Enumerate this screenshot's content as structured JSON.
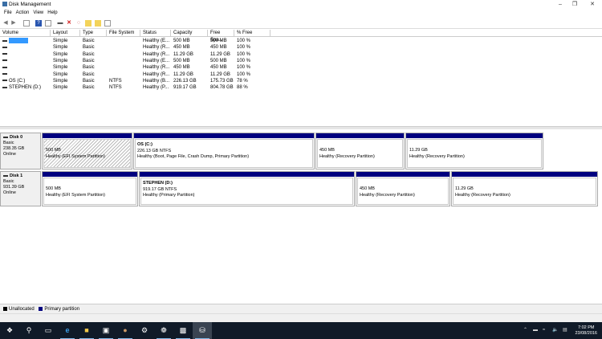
{
  "window": {
    "title": "Disk Management",
    "controls": [
      "minimize",
      "maximize",
      "close"
    ]
  },
  "menu": [
    "File",
    "Action",
    "View",
    "Help"
  ],
  "toolbar": [
    "back-icon",
    "forward-icon",
    "console-tree-icon",
    "help-icon",
    "properties-icon",
    "connect-icon",
    "delete-icon",
    "refresh-icon",
    "new-icon",
    "open-icon",
    "view-icon"
  ],
  "list": {
    "columns": [
      "Volume",
      "Layout",
      "Type",
      "File System",
      "Status",
      "Capacity",
      "Free Spa...",
      "% Free"
    ],
    "rows": [
      {
        "volume": "",
        "layout": "Simple",
        "type": "Basic",
        "fs": "",
        "status": "Healthy (E...",
        "capacity": "500 MB",
        "free": "500 MB",
        "pct": "100 %",
        "selected": true
      },
      {
        "volume": "",
        "layout": "Simple",
        "type": "Basic",
        "fs": "",
        "status": "Healthy (R...",
        "capacity": "450 MB",
        "free": "450 MB",
        "pct": "100 %"
      },
      {
        "volume": "",
        "layout": "Simple",
        "type": "Basic",
        "fs": "",
        "status": "Healthy (R...",
        "capacity": "11.29 GB",
        "free": "11.29 GB",
        "pct": "100 %"
      },
      {
        "volume": "",
        "layout": "Simple",
        "type": "Basic",
        "fs": "",
        "status": "Healthy (E...",
        "capacity": "500 MB",
        "free": "500 MB",
        "pct": "100 %"
      },
      {
        "volume": "",
        "layout": "Simple",
        "type": "Basic",
        "fs": "",
        "status": "Healthy (R...",
        "capacity": "450 MB",
        "free": "450 MB",
        "pct": "100 %"
      },
      {
        "volume": "",
        "layout": "Simple",
        "type": "Basic",
        "fs": "",
        "status": "Healthy (R...",
        "capacity": "11.29 GB",
        "free": "11.29 GB",
        "pct": "100 %"
      },
      {
        "volume": "OS (C:)",
        "layout": "Simple",
        "type": "Basic",
        "fs": "NTFS",
        "status": "Healthy (B...",
        "capacity": "226.13 GB",
        "free": "175.73 GB",
        "pct": "78 %"
      },
      {
        "volume": "STEPHEN (D:)",
        "layout": "Simple",
        "type": "Basic",
        "fs": "NTFS",
        "status": "Healthy (P...",
        "capacity": "919.17 GB",
        "free": "804.78 GB",
        "pct": "88 %"
      }
    ]
  },
  "disks": [
    {
      "name": "Disk 0",
      "type": "Basic",
      "size": "238.35 GB",
      "state": "Online",
      "partitions": [
        {
          "title": "",
          "size": "500 MB",
          "status": "Healthy (EFI System Partition)",
          "hatched": true
        },
        {
          "title": "OS  (C:)",
          "size": "226.13 GB NTFS",
          "status": "Healthy (Boot, Page File, Crash Dump, Primary Partition)"
        },
        {
          "title": "",
          "size": "450 MB",
          "status": "Healthy (Recovery Partition)"
        },
        {
          "title": "",
          "size": "11.29 GB",
          "status": "Healthy (Recovery Partition)"
        }
      ]
    },
    {
      "name": "Disk 1",
      "type": "Basic",
      "size": "931.39 GB",
      "state": "Online",
      "partitions": [
        {
          "title": "",
          "size": "500 MB",
          "status": "Healthy (EFI System Partition)"
        },
        {
          "title": "STEPHEN  (D:)",
          "size": "919.17 GB NTFS",
          "status": "Healthy (Primary Partition)"
        },
        {
          "title": "",
          "size": "450 MB",
          "status": "Healthy (Recovery Partition)"
        },
        {
          "title": "",
          "size": "11.29 GB",
          "status": "Healthy (Recovery Partition)"
        }
      ]
    }
  ],
  "legend": [
    {
      "label": "Unallocated",
      "color": "#000000"
    },
    {
      "label": "Primary partition",
      "color": "#00007f"
    }
  ],
  "taskbar": {
    "apps": [
      "start",
      "search",
      "task-view",
      "edge",
      "file-explorer",
      "store",
      "app-person",
      "settings",
      "paint",
      "command-prompt",
      "disk-management"
    ],
    "time": "7:02 PM",
    "date": "23/08/2016"
  }
}
